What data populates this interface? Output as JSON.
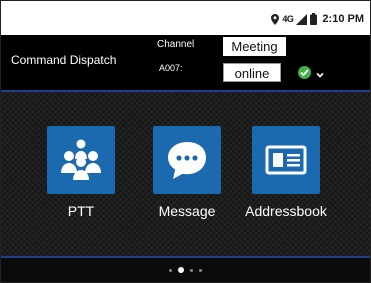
{
  "status_bar": {
    "network": "4G",
    "time": "2:10 PM",
    "icons": [
      "location-icon",
      "signal-icon",
      "battery-icon"
    ]
  },
  "header": {
    "title": "Command Dispatch",
    "channel_label": "Channel",
    "channel_value": "Meeting",
    "user_label": "A007:",
    "status_value": "online",
    "status_color": "#3fb34a"
  },
  "apps": [
    {
      "label": "PTT",
      "icon": "group-icon"
    },
    {
      "label": "Message",
      "icon": "chat-bubble-icon"
    },
    {
      "label": "Addressbook",
      "icon": "contact-card-icon"
    }
  ],
  "pager": {
    "pages": 4,
    "active_page": 2
  },
  "colors": {
    "accent": "#1b6ab0",
    "divider": "#1e3f8a",
    "background": "#171717"
  }
}
